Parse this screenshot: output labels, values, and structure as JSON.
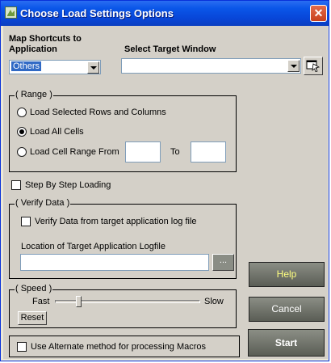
{
  "window": {
    "title": "Choose Load Settings Options",
    "close_glyph": "✕"
  },
  "shortcuts": {
    "label": "Map Shortcuts to Application",
    "selected": "Others"
  },
  "target_window": {
    "label": "Select Target Window",
    "value": ""
  },
  "range": {
    "title": "( Range )",
    "options": [
      "Load Selected Rows and Columns",
      "Load All Cells",
      "Load Cell Range From"
    ],
    "selected_index": 1,
    "to_label": "To",
    "from_value": "",
    "to_value": ""
  },
  "step_by_step": {
    "label": "Step By Step Loading",
    "checked": false
  },
  "verify": {
    "title": "( Verify Data )",
    "checkbox_label": "Verify Data from target application log file",
    "checked": false,
    "location_label": "Location of Target Application Logfile",
    "path_value": "",
    "browse_label": "..."
  },
  "speed": {
    "title": "( Speed )",
    "fast_label": "Fast",
    "slow_label": "Slow",
    "reset_label": "Reset",
    "level": 0.15
  },
  "alternate": {
    "label": "Use Alternate method for processing Macros",
    "checked": false
  },
  "buttons": {
    "help": "Help",
    "cancel": "Cancel",
    "start": "Start"
  },
  "colors": {
    "title_bar": "#0a56e8",
    "help_text": "#ffff80",
    "dialog_bg": "#d4d0c8"
  }
}
